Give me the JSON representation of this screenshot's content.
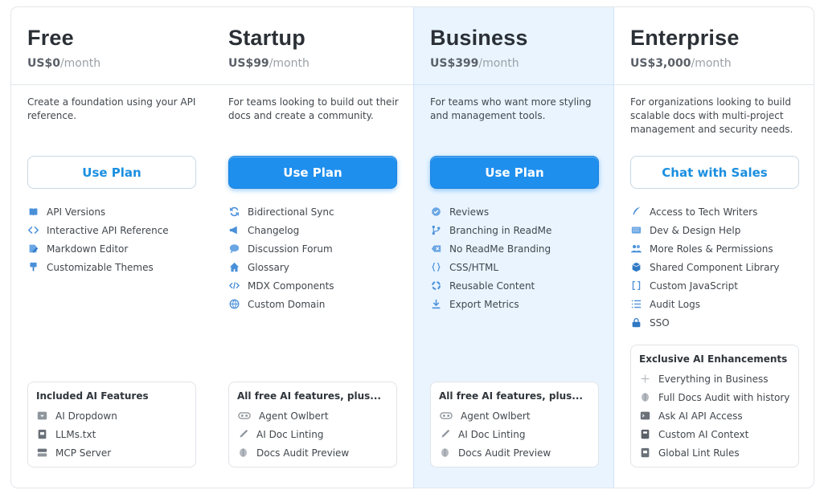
{
  "plans": [
    {
      "name": "Free",
      "price": "US$0",
      "period": "/month",
      "description": "Create a foundation using your API reference.",
      "cta": "Use Plan",
      "features": [
        {
          "icon": "book-icon",
          "label": "API Versions"
        },
        {
          "icon": "code-brackets-icon",
          "label": "Interactive API Reference"
        },
        {
          "icon": "markdown-edit-icon",
          "label": "Markdown Editor"
        },
        {
          "icon": "paint-brush-icon",
          "label": "Customizable Themes"
        }
      ],
      "ai_box": {
        "title": "Included AI Features",
        "items": [
          {
            "icon": "dropdown-icon",
            "label": "AI Dropdown"
          },
          {
            "icon": "file-text-icon",
            "label": "LLMs.txt"
          },
          {
            "icon": "server-icon",
            "label": "MCP Server"
          }
        ]
      }
    },
    {
      "name": "Startup",
      "price": "US$99",
      "period": "/month",
      "description": "For teams looking to build out their docs and create a community.",
      "cta": "Use Plan",
      "features": [
        {
          "icon": "sync-icon",
          "label": "Bidirectional Sync"
        },
        {
          "icon": "megaphone-icon",
          "label": "Changelog"
        },
        {
          "icon": "chat-bubble-icon",
          "label": "Discussion Forum"
        },
        {
          "icon": "house-icon",
          "label": "Glossary"
        },
        {
          "icon": "code-slash-icon",
          "label": "MDX Components"
        },
        {
          "icon": "globe-icon",
          "label": "Custom Domain"
        }
      ],
      "ai_box": {
        "title": "All free AI features, plus...",
        "items": [
          {
            "icon": "owl-icon",
            "label": "Agent Owlbert"
          },
          {
            "icon": "pen-icon",
            "label": "AI Doc Linting"
          },
          {
            "icon": "brain-icon",
            "label": "Docs Audit Preview"
          }
        ]
      }
    },
    {
      "name": "Business",
      "price": "US$399",
      "period": "/month",
      "description": "For teams who want more styling and management tools.",
      "cta": "Use Plan",
      "features": [
        {
          "icon": "check-badge-icon",
          "label": "Reviews"
        },
        {
          "icon": "git-branch-icon",
          "label": "Branching in ReadMe"
        },
        {
          "icon": "backspace-icon",
          "label": "No ReadMe Branding"
        },
        {
          "icon": "braces-icon",
          "label": "CSS/HTML"
        },
        {
          "icon": "recycle-icon",
          "label": "Reusable Content"
        },
        {
          "icon": "download-icon",
          "label": "Export Metrics"
        }
      ],
      "ai_box": {
        "title": "All free AI features, plus...",
        "items": [
          {
            "icon": "owl-icon",
            "label": "Agent Owlbert"
          },
          {
            "icon": "pen-icon",
            "label": "AI Doc Linting"
          },
          {
            "icon": "brain-icon",
            "label": "Docs Audit Preview"
          }
        ]
      }
    },
    {
      "name": "Enterprise",
      "price": "US$3,000",
      "period": "/month",
      "description": "For organizations looking to build scalable docs with multi-project management and security needs.",
      "cta": "Chat with Sales",
      "features": [
        {
          "icon": "quill-icon",
          "label": "Access to Tech Writers"
        },
        {
          "icon": "keyboard-icon",
          "label": "Dev & Design Help"
        },
        {
          "icon": "people-icon",
          "label": "More Roles & Permissions"
        },
        {
          "icon": "cube-icon",
          "label": "Shared Component Library"
        },
        {
          "icon": "square-brackets-icon",
          "label": "Custom JavaScript"
        },
        {
          "icon": "list-icon",
          "label": "Audit Logs"
        },
        {
          "icon": "lock-icon",
          "label": "SSO"
        }
      ],
      "ai_box": {
        "title": "Exclusive AI Enhancements",
        "items": [
          {
            "icon": "plus-icon",
            "label": "Everything in Business"
          },
          {
            "icon": "brain-icon",
            "label": "Full Docs Audit with history"
          },
          {
            "icon": "terminal-icon",
            "label": "Ask AI API Access"
          },
          {
            "icon": "notebook-icon",
            "label": "Custom AI Context"
          },
          {
            "icon": "file-text-icon",
            "label": "Global Lint Rules"
          }
        ]
      }
    }
  ],
  "colors": {
    "accent": "#1f8fee",
    "highlight_column_bg": "#e9f4ff",
    "icon_blue": "#4a90d9",
    "icon_gray": "#8f969d"
  }
}
